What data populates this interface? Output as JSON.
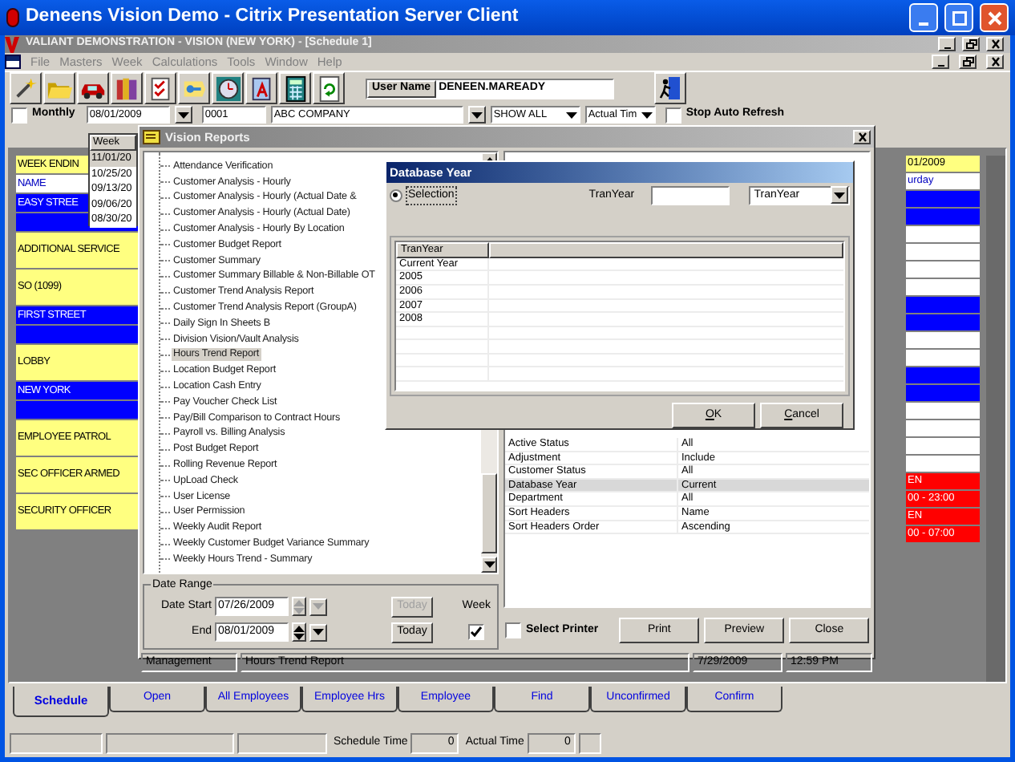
{
  "window": {
    "title": "Deneens Vision Demo - Citrix Presentation Server Client"
  },
  "mdi": {
    "title": "VALIANT DEMONSTRATION - VISION (NEW YORK) - [Schedule 1]"
  },
  "menu": [
    {
      "label": "File",
      "disabled": true
    },
    {
      "label": "Masters",
      "disabled": true
    },
    {
      "label": "Week",
      "disabled": true
    },
    {
      "label": "Calculations",
      "disabled": true
    },
    {
      "label": "Tools",
      "disabled": true
    },
    {
      "label": "Window",
      "disabled": true
    },
    {
      "label": "Help",
      "disabled": true
    }
  ],
  "toolbar": {
    "user_name_label": "User Name",
    "user_name": "DENEEN.MAREADY"
  },
  "filter": {
    "monthly": {
      "label": "Monthly",
      "checked": false
    },
    "date": "08/01/2009",
    "customer_code": "0001",
    "customer_name": "ABC COMPANY",
    "show": "SHOW ALL",
    "time": "Actual Tim",
    "auto_refresh": {
      "label": "Stop Auto Refresh",
      "checked": false
    }
  },
  "week_list": {
    "header": "Week",
    "items": [
      {
        "label": "11/01/20",
        "selected": true
      },
      {
        "label": "10/25/20",
        "selected": false
      },
      {
        "label": "09/13/20",
        "selected": false
      },
      {
        "label": "09/06/20",
        "selected": false
      },
      {
        "label": "08/30/20",
        "selected": false
      }
    ]
  },
  "schedule": {
    "left": [
      {
        "kind": "header",
        "text": "WEEK ENDIN"
      },
      {
        "kind": "name",
        "text": "NAME"
      },
      {
        "kind": "site",
        "text": "EASY STREE"
      },
      {
        "kind": "site_blank"
      },
      {
        "kind": "post",
        "text": "ADDITIONAL SERVICE"
      },
      {
        "kind": "post",
        "text": "SO (1099)"
      },
      {
        "kind": "site",
        "text": "FIRST STREET"
      },
      {
        "kind": "site_blank"
      },
      {
        "kind": "post",
        "text": "LOBBY"
      },
      {
        "kind": "site",
        "text": "NEW YORK"
      },
      {
        "kind": "site_blank"
      },
      {
        "kind": "post",
        "text": "EMPLOYEE PATROL"
      },
      {
        "kind": "post",
        "text": "SEC OFFICER ARMED"
      },
      {
        "kind": "post",
        "text": "SECURITY OFFICER"
      }
    ],
    "right": [
      {
        "kind": "date",
        "text": "01/2009"
      },
      {
        "kind": "day",
        "text": "urday"
      },
      {
        "kind": "site"
      },
      {
        "kind": "site"
      },
      {
        "kind": "empty"
      },
      {
        "kind": "empty"
      },
      {
        "kind": "empty"
      },
      {
        "kind": "empty"
      },
      {
        "kind": "site"
      },
      {
        "kind": "site"
      },
      {
        "kind": "empty"
      },
      {
        "kind": "empty"
      },
      {
        "kind": "site"
      },
      {
        "kind": "site"
      },
      {
        "kind": "empty"
      },
      {
        "kind": "empty"
      },
      {
        "kind": "empty"
      },
      {
        "kind": "empty"
      },
      {
        "kind": "alert",
        "text": "EN"
      },
      {
        "kind": "alert",
        "text": "00 - 23:00"
      },
      {
        "kind": "alert",
        "text": "EN"
      },
      {
        "kind": "alert",
        "text": "00 - 07:00"
      }
    ]
  },
  "reports": {
    "title": "Vision Reports",
    "items": [
      {
        "label": "Attendance Verification",
        "selected": false
      },
      {
        "label": "Customer Analysis - Hourly",
        "selected": false
      },
      {
        "label": "Customer Analysis - Hourly (Actual Date &",
        "selected": false
      },
      {
        "label": "Customer Analysis - Hourly (Actual Date)",
        "selected": false
      },
      {
        "label": "Customer Analysis - Hourly By Location",
        "selected": false
      },
      {
        "label": "Customer Budget Report",
        "selected": false
      },
      {
        "label": "Customer Summary",
        "selected": false
      },
      {
        "label": "Customer Summary Billable & Non-Billable OT",
        "selected": false
      },
      {
        "label": "Customer Trend Analysis Report",
        "selected": false
      },
      {
        "label": "Customer Trend Analysis Report (GroupA)",
        "selected": false
      },
      {
        "label": "Daily Sign In Sheets B",
        "selected": false
      },
      {
        "label": "Division Vision/Vault Analysis",
        "selected": false
      },
      {
        "label": "Hours Trend Report",
        "selected": true
      },
      {
        "label": "Location Budget Report",
        "selected": false
      },
      {
        "label": "Location Cash Entry",
        "selected": false
      },
      {
        "label": "Pay Voucher Check List",
        "selected": false
      },
      {
        "label": "Pay/Bill Comparison to Contract Hours",
        "selected": false
      },
      {
        "label": "Payroll vs. Billing Analysis",
        "selected": false
      },
      {
        "label": "Post Budget Report",
        "selected": false
      },
      {
        "label": "Rolling Revenue Report",
        "selected": false
      },
      {
        "label": "UpLoad Check",
        "selected": false
      },
      {
        "label": "User License",
        "selected": false
      },
      {
        "label": "User Permission",
        "selected": false
      },
      {
        "label": "Weekly Audit Report",
        "selected": false
      },
      {
        "label": "Weekly Customer Budget Variance Summary",
        "selected": false
      },
      {
        "label": "Weekly Hours Trend - Summary",
        "selected": false
      }
    ],
    "date_range": {
      "title": "Date Range",
      "week_label": "Week",
      "week_checked": true,
      "dates": [
        {
          "label": "Date Start",
          "value": "07/26/2009",
          "today": "Today",
          "today_disabled": true
        },
        {
          "label": "End",
          "value": "08/01/2009",
          "today": "Today",
          "today_disabled": false
        }
      ]
    },
    "params": [
      {
        "name": "Active Status",
        "value": "All",
        "selected": false
      },
      {
        "name": "Adjustment",
        "value": "Include",
        "selected": false
      },
      {
        "name": "Customer Status",
        "value": "All",
        "selected": false
      },
      {
        "name": "Database Year",
        "value": "Current",
        "selected": true
      },
      {
        "name": "Department",
        "value": "All",
        "selected": false
      },
      {
        "name": "Sort Headers",
        "value": "Name",
        "selected": false
      },
      {
        "name": "Sort Headers Order",
        "value": "Ascending",
        "selected": false
      }
    ],
    "select_printer": {
      "label": "Select Printer",
      "checked": false
    },
    "buttons": [
      "Print",
      "Preview",
      "Close"
    ],
    "status": {
      "module": "Management",
      "report": "Hours Trend Report",
      "date": "7/29/2009",
      "time": "12:59 PM"
    }
  },
  "dialog": {
    "title": "Database Year",
    "radio": {
      "label": "Selection",
      "selected": true
    },
    "field_label": "TranYear",
    "select": "TranYear",
    "column": "TranYear",
    "rows": [
      "Current Year",
      "2005",
      "2006",
      "2007",
      "2008"
    ],
    "buttons": [
      "OK",
      "Cancel"
    ]
  },
  "tabs": [
    {
      "label": "Schedule",
      "selected": true
    },
    {
      "label": "Open",
      "selected": false
    },
    {
      "label": "All Employees",
      "selected": false
    },
    {
      "label": "Employee Hrs",
      "selected": false
    },
    {
      "label": "Employee",
      "selected": false
    },
    {
      "label": "Find",
      "selected": false
    },
    {
      "label": "Unconfirmed",
      "selected": false
    },
    {
      "label": "Confirm",
      "selected": false
    }
  ],
  "status_bar": {
    "schedule_time_label": "Schedule Time",
    "schedule_time": "0",
    "actual_time_label": "Actual Time",
    "actual_time": "0"
  }
}
